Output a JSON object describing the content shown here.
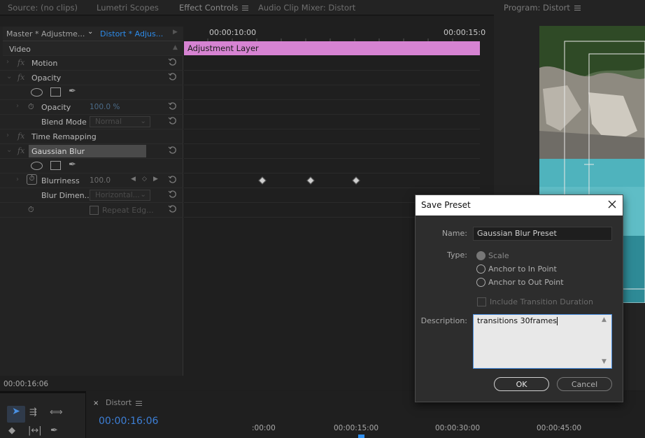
{
  "tabs": [
    {
      "label": "Source: (no clips)"
    },
    {
      "label": "Lumetri Scopes"
    },
    {
      "label": "Effect Controls"
    },
    {
      "label": "Audio Clip Mixer: Distort"
    }
  ],
  "program_tab": {
    "label": "Program: Distort"
  },
  "effect_controls": {
    "master_label": "Master * Adjustme...",
    "sequence_label": "Distort * Adjus...",
    "timecode_1": "00:00:10:00",
    "timecode_2": "00:00:15:0",
    "clip_name": "Adjustment Layer",
    "section_label": "Video",
    "rows": {
      "motion": "Motion",
      "opacity_fx": "Opacity",
      "opacity_param": "Opacity",
      "opacity_value": "100.0 %",
      "blend_label": "Blend Mode",
      "blend_value": "Normal",
      "time_remap": "Time Remapping",
      "gaussian": "Gaussian Blur",
      "blurriness": "Blurriness",
      "blurriness_value": "100.0",
      "blur_dim": "Blur Dimen...",
      "blur_dim_value": "Horizontal...",
      "repeat_edge": "Repeat Edg..."
    },
    "current_time": "00:00:16:06"
  },
  "dialog": {
    "title": "Save Preset",
    "name_label": "Name:",
    "name_value": "Gaussian Blur Preset",
    "type_label": "Type:",
    "types": [
      "Scale",
      "Anchor to In Point",
      "Anchor to Out Point"
    ],
    "include_label": "Include Transition Duration",
    "description_label": "Description:",
    "description_value": "transitions 30frames",
    "ok_label": "OK",
    "cancel_label": "Cancel"
  },
  "timeline": {
    "close_symbol": "×",
    "sequence_tab": "Distort",
    "timecode": "00:00:16:06",
    "ruler": [
      ":00:00",
      "00:00:15:00",
      "00:00:30:00",
      "00:00:45:00"
    ]
  },
  "colors": {
    "clip": "#d683d2",
    "accent_blue": "#2d8ceb",
    "panel": "#232323"
  }
}
